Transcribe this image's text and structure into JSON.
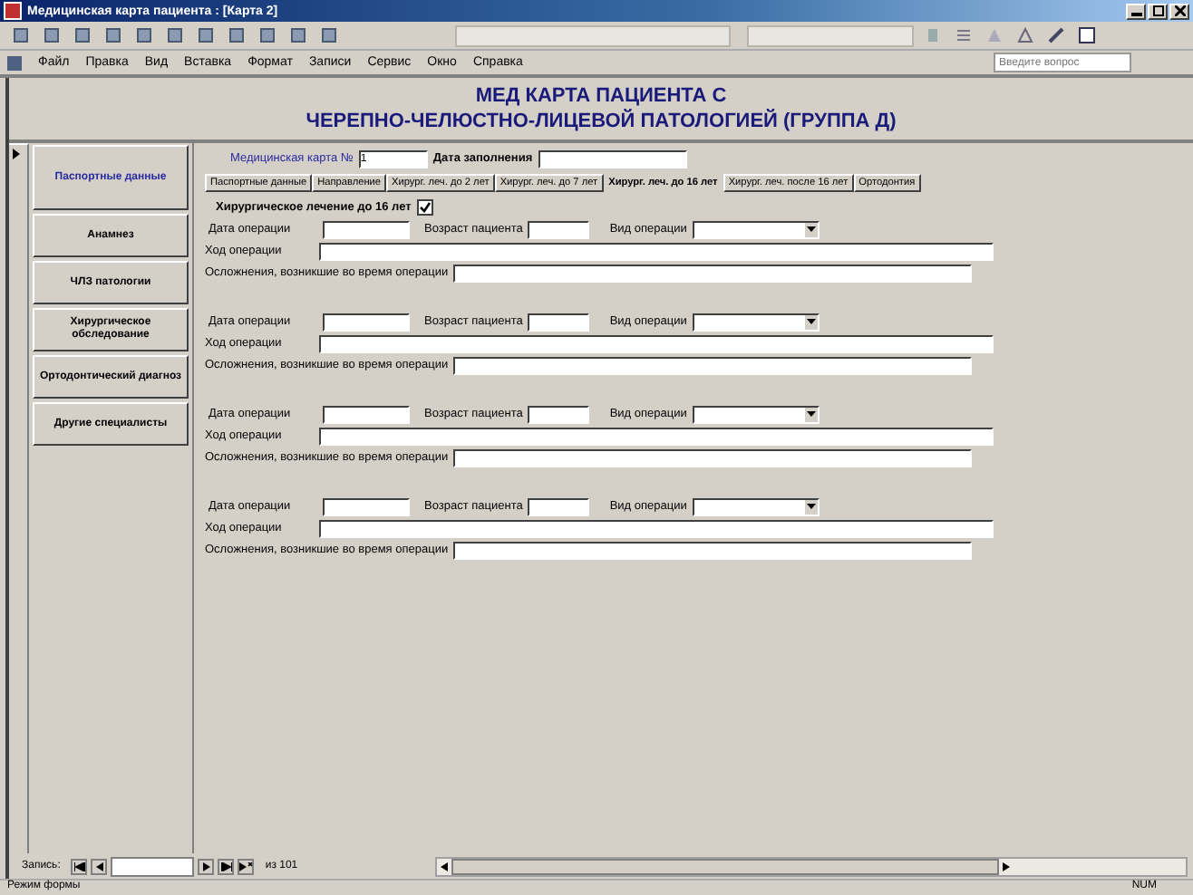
{
  "window": {
    "title": "Медицинская карта пациента : [Карта 2]"
  },
  "menu": [
    "Файл",
    "Правка",
    "Вид",
    "Вставка",
    "Формат",
    "Записи",
    "Сервис",
    "Окно",
    "Справка"
  ],
  "help_search": {
    "placeholder": "Введите вопрос"
  },
  "form": {
    "title_lines": [
      "МЕД КАРТА ПАЦИЕНТА С",
      "ЧЕРЕПНО-ЧЕЛЮСТНО-ЛИЦЕВОЙ ПАТОЛОГИЕЙ (ГРУППА Д)"
    ],
    "card_number": {
      "label": "Медицинская карта №",
      "value": "1"
    },
    "fill_date": {
      "label": "Дата заполнения"
    }
  },
  "sidebar": [
    {
      "label": "Паспортные данные",
      "selected": true
    },
    {
      "label": "Анамнез",
      "selected": false
    },
    {
      "label": "ЧЛЗ патологии",
      "selected": false
    },
    {
      "label": "Хирургическое обследование",
      "selected": false
    },
    {
      "label": "Ортодонтический диагноз",
      "selected": false
    },
    {
      "label": "Другие специалисты",
      "selected": false
    }
  ],
  "tabs": [
    {
      "label": "Паспортные данные",
      "selected": false
    },
    {
      "label": "Направление",
      "selected": false
    },
    {
      "label": "Хирург. леч. до 2 лет",
      "selected": false
    },
    {
      "label": "Хирург. леч. до 7 лет",
      "selected": false
    },
    {
      "label": "Хирург. леч. до 16 лет",
      "selected": true
    },
    {
      "label": "Хирург. леч. после 16 лет",
      "selected": false
    },
    {
      "label": "Ортодонтия",
      "selected": false
    }
  ],
  "section_checkbox": {
    "label": "Хирургическое лечение до 16 лет",
    "checked": true
  },
  "operations": [
    {
      "date_label": "Дата операции",
      "age_label": "Возраст пациента",
      "type_label": "Вид операции",
      "course_label": "Ход операции",
      "complications_label": "Осложнения, возникшие во время операции"
    },
    {
      "date_label": "Дата операции",
      "age_label": "Возраст пациента",
      "type_label": "Вид операции",
      "course_label": "Ход операции",
      "complications_label": "Осложнения, возникшие во время операции"
    },
    {
      "date_label": "Дата операции",
      "age_label": "Возраст пациента",
      "type_label": "Вид операции",
      "course_label": "Ход операции",
      "complications_label": "Осложнения, возникшие во время операции"
    },
    {
      "date_label": "Дата операции",
      "age_label": "Возраст пациента",
      "type_label": "Вид операции",
      "course_label": "Ход операции",
      "complications_label": "Осложнения, возникшие во время операции"
    }
  ],
  "record_nav": {
    "label": "Запись:",
    "total": "из 101"
  },
  "status_bar": {
    "text": "Режим формы",
    "indicator": "NUM"
  }
}
